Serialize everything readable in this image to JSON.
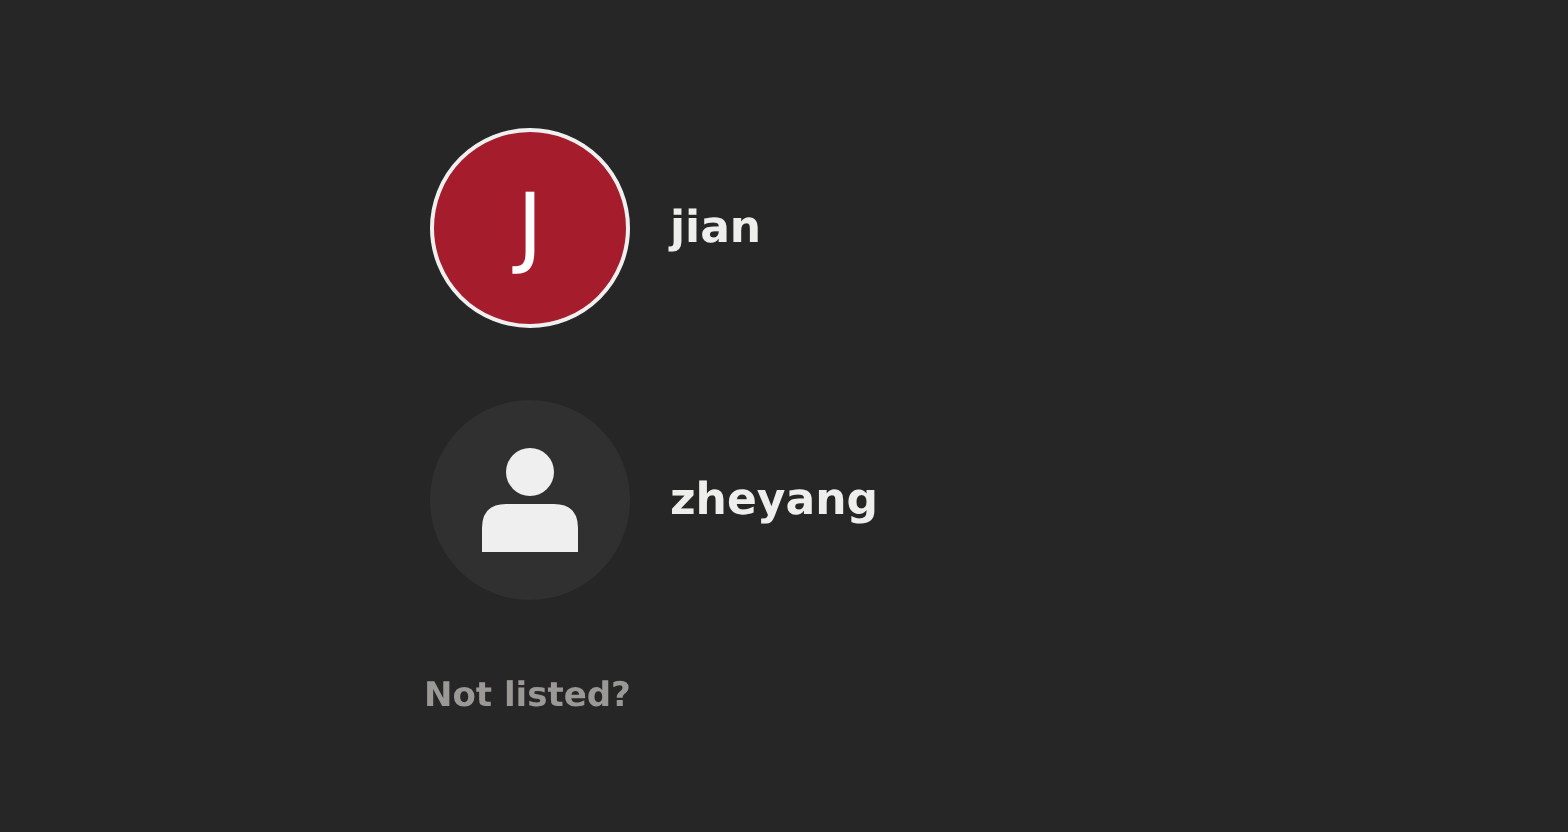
{
  "users": [
    {
      "name": "jian",
      "avatar": {
        "kind": "initial",
        "initial": "J",
        "color": "#a51d2d"
      },
      "selected": true
    },
    {
      "name": "zheyang",
      "avatar": {
        "kind": "silhouette",
        "color": "#303030"
      },
      "selected": false
    }
  ],
  "not_listed": "Not listed?"
}
